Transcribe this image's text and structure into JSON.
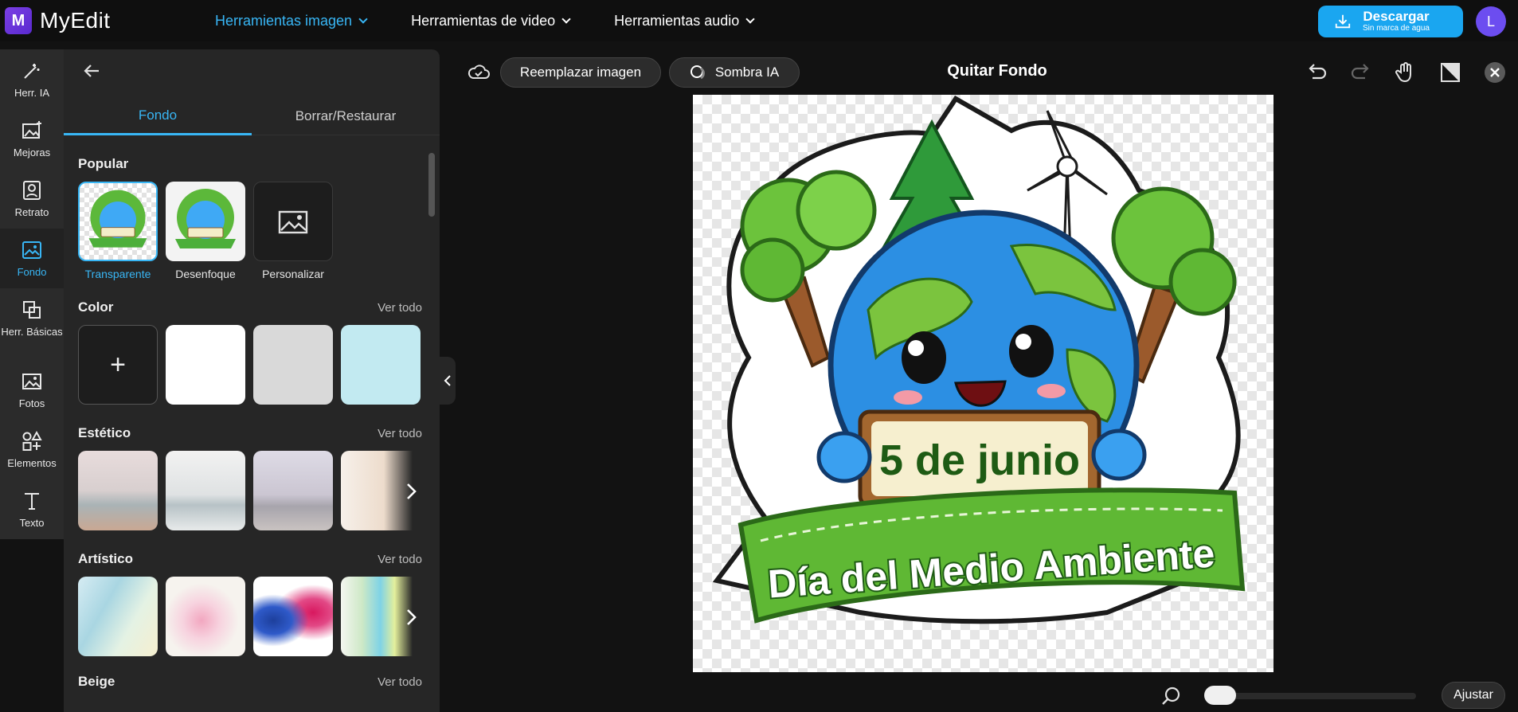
{
  "app": {
    "logo_text": "MyEdit",
    "logo_mark": "M"
  },
  "topnav": [
    {
      "label": "Herramientas imagen",
      "active": true
    },
    {
      "label": "Herramientas de video",
      "active": false
    },
    {
      "label": "Herramientas audio",
      "active": false
    }
  ],
  "download": {
    "label": "Descargar",
    "sublabel": "Sin marca de agua",
    "icon": "download-icon"
  },
  "user": {
    "avatar_letter": "L"
  },
  "rail": [
    {
      "label": "Herr. IA",
      "icon": "magic-wand-icon"
    },
    {
      "label": "Mejoras",
      "icon": "enhance-icon"
    },
    {
      "label": "Retrato",
      "icon": "portrait-icon"
    },
    {
      "label": "Fondo",
      "icon": "background-icon",
      "active": true
    },
    {
      "label": "Herr. Básicas",
      "icon": "basic-tools-icon"
    },
    {
      "label": "Fotos",
      "icon": "photos-icon"
    },
    {
      "label": "Elementos",
      "icon": "elements-icon"
    },
    {
      "label": "Texto",
      "icon": "text-icon"
    }
  ],
  "panel": {
    "tabs": [
      {
        "label": "Fondo",
        "active": true
      },
      {
        "label": "Borrar/Restaurar",
        "active": false
      }
    ],
    "popular": {
      "title": "Popular",
      "items": [
        {
          "label": "Transparente",
          "active": true
        },
        {
          "label": "Desenfoque",
          "active": false
        },
        {
          "label": "Personalizar",
          "active": false
        }
      ]
    },
    "color": {
      "title": "Color",
      "see_all": "Ver todo",
      "swatches": [
        "#ffffff",
        "#d9d9d9",
        "#c2eaf1"
      ],
      "add_symbol": "+"
    },
    "estetico": {
      "title": "Estético",
      "see_all": "Ver todo"
    },
    "artistico": {
      "title": "Artístico",
      "see_all": "Ver todo"
    },
    "beige": {
      "title": "Beige",
      "see_all": "Ver todo"
    }
  },
  "canvas": {
    "title": "Quitar Fondo",
    "replace_label": "Reemplazar imagen",
    "shadow_label": "Sombra IA",
    "artwork": {
      "date_text": "5 de junio",
      "banner_text": "Día del Medio Ambiente"
    }
  },
  "zoom": {
    "fit_label": "Ajustar"
  }
}
